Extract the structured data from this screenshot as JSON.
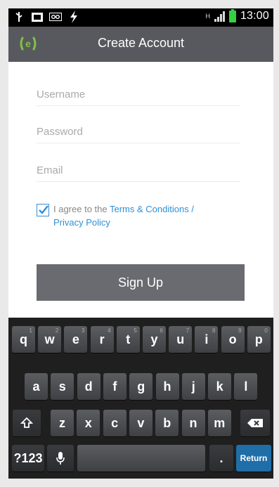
{
  "status_bar": {
    "time": "13:00",
    "network_label": "H",
    "icons": [
      "usb-icon",
      "photo-notification-icon",
      "voicemail-icon",
      "lightning-icon",
      "signal-icon",
      "battery-icon"
    ]
  },
  "header": {
    "title": "Create Account",
    "logo_text": "e"
  },
  "form": {
    "username_placeholder": "Username",
    "password_placeholder": "Password",
    "email_placeholder": "Email",
    "agree_text": "I agree to the ",
    "terms_link": "Terms & Conditions /",
    "privacy_link": "Privacy Policy",
    "agree_checked": true,
    "signup_label": "Sign Up"
  },
  "keyboard": {
    "row1": [
      {
        "key": "q",
        "hint": "1"
      },
      {
        "key": "w",
        "hint": "2"
      },
      {
        "key": "e",
        "hint": "3"
      },
      {
        "key": "r",
        "hint": "4"
      },
      {
        "key": "t",
        "hint": "5"
      },
      {
        "key": "y",
        "hint": "6"
      },
      {
        "key": "u",
        "hint": "7"
      },
      {
        "key": "i",
        "hint": "8"
      },
      {
        "key": "o",
        "hint": "9"
      },
      {
        "key": "p",
        "hint": "0"
      }
    ],
    "row2": [
      "a",
      "s",
      "d",
      "f",
      "g",
      "h",
      "j",
      "k",
      "l"
    ],
    "row3": [
      "z",
      "x",
      "c",
      "v",
      "b",
      "n",
      "m"
    ],
    "mode_label": "?123",
    "period_label": ".",
    "return_label": "Return"
  },
  "colors": {
    "action_bar": "#58595e",
    "link": "#2f8fd6",
    "button": "#6a6b70",
    "return_key": "#1f6ea8",
    "battery": "#35d13f"
  }
}
